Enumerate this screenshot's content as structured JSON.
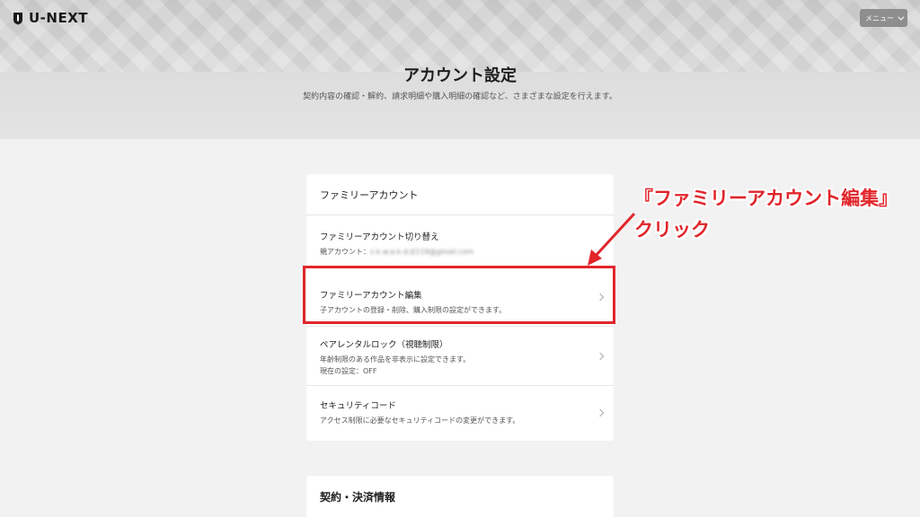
{
  "header": {
    "logo_text": "U-NEXT",
    "menu_label": "メニュー",
    "page_title": "アカウント設定",
    "page_subtitle": "契約内容の確認・解約、請求明細や購入明細の確認など、さまざまな設定を行えます。"
  },
  "family_card": {
    "heading": "ファミリーアカウント",
    "rows": [
      {
        "title": "ファミリーアカウント切り替え",
        "desc_label": "親アカウント：",
        "desc_value": "s.k.w.a.k.d-jt119@gmail.com"
      },
      {
        "title": "ファミリーアカウント編集",
        "desc": "子アカウントの登録・削除、購入制限の設定ができます。"
      },
      {
        "title": "ペアレンタルロック（視聴制限）",
        "desc": "年齢制限のある作品を非表示に設定できます。",
        "desc2": "現在の設定：OFF"
      },
      {
        "title": "セキュリティコード",
        "desc": "アクセス制限に必要なセキュリティコードの変更ができます。"
      }
    ]
  },
  "contract_card": {
    "heading": "契約・決済情報"
  },
  "annotation": {
    "title": "『ファミリーアカウント編集』",
    "action": "クリック",
    "color": "#e0262b"
  }
}
